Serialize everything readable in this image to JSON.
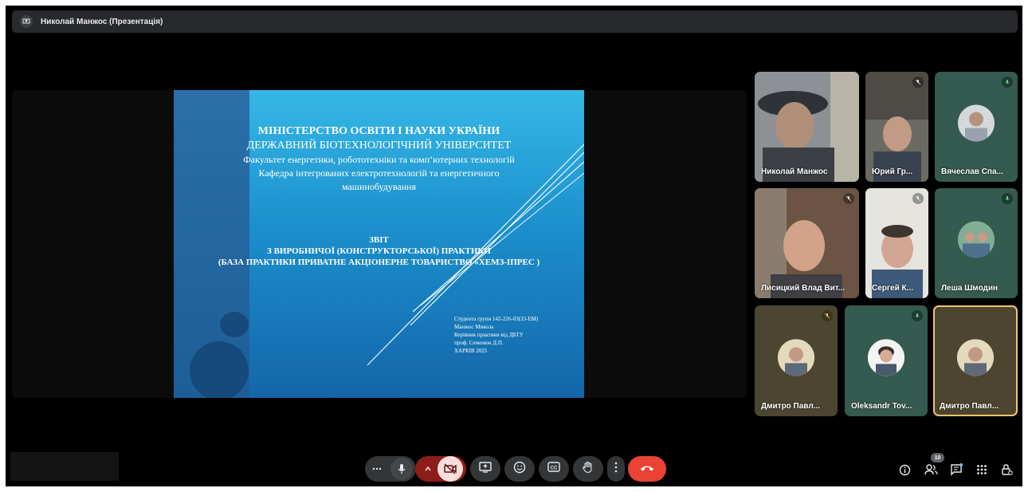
{
  "topbar": {
    "title": "Николай Манжос (Презентація)",
    "icon": "present-to-all-icon"
  },
  "slide": {
    "heading1": "МІНІСТЕРСТВО ОСВІТИ І НАУКИ УКРАЇНИ",
    "heading2": "ДЕРЖАВНИЙ БІОТЕХНОЛОГІЧНИЙ УНІВЕРСИТЕТ",
    "line3": "Факультет енергетики, робототехніки та комп’ютерних технологій",
    "line4": "Кафедра інтегрованих електротехнологій та енергетичного",
    "line5": "машинобудування",
    "report1": "ЗВІТ",
    "report2": "З ВИРОБНИЧОЇ (КОНСТРУКТОРСЬКОЇ) ПРАКТИКИ",
    "report3": "(БАЗА ПРАКТИКИ ПРИВАТНЕ АКЦІОНЕРНЕ ТОВАРИСТВО «ХЕМЗ-ІПРЕС )",
    "info1": "Студента групи 142-226-03(33-ЕМ)",
    "info2": "Манжос Микола",
    "info3": "Керівник практики від ДБТУ",
    "info4": "проф. Семенюк Д.П.",
    "info5": "ХАРКІВ 2025"
  },
  "participants": [
    {
      "name": "Николай Манжос",
      "muted": false
    },
    {
      "name": "Юрий Гр...",
      "muted": true
    },
    {
      "name": "Вячеслав Спа...",
      "muted": false
    },
    {
      "name": "Лисицкий Влад Вит...",
      "muted": true
    },
    {
      "name": "Сергей К...",
      "muted": true
    },
    {
      "name": "Леша Шмодин",
      "muted": false
    },
    {
      "name": "Дмитро Павл...",
      "muted": true
    },
    {
      "name": "Oleksandr Tov...",
      "muted": false
    },
    {
      "name": "Дмитро Павл...",
      "muted": false
    }
  ],
  "controls": {
    "more_options": "more-horizontal-icon",
    "mic": "mic-icon",
    "chevron": "chevron-up-icon",
    "camera": "camera-off-icon",
    "present": "present-screen-icon",
    "emoji": "emoji-icon",
    "captions": "captions-icon",
    "hand": "raise-hand-icon",
    "more": "more-vertical-icon",
    "hangup": "hang-up-icon"
  },
  "right_controls": {
    "people_count": "10"
  },
  "colors": {
    "hangup": "#ea4335",
    "camera_off_bg": "#f9dedc",
    "highlight": "#f3c46d",
    "button_bg": "#333537"
  }
}
